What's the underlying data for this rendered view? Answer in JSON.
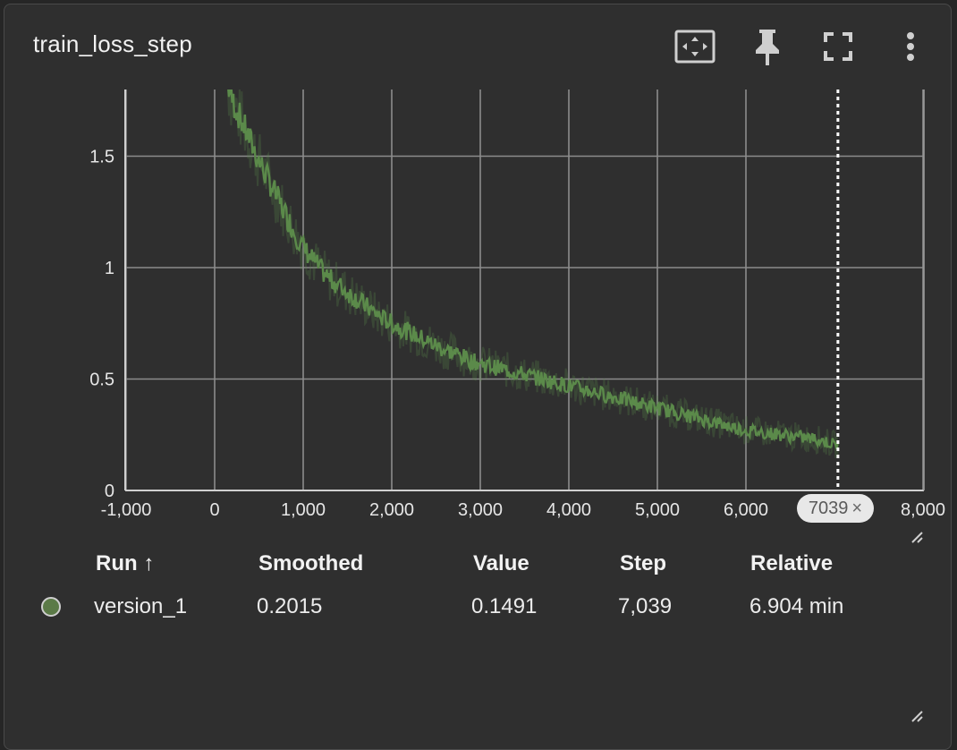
{
  "card": {
    "title": "train_loss_step"
  },
  "toolbar": {
    "fit_icon": "fit-domain-icon",
    "pin_icon": "pin-icon",
    "fullscreen_icon": "fullscreen-icon",
    "more_icon": "more-vert-icon"
  },
  "chart_data": {
    "type": "line",
    "title": "train_loss_step",
    "xlabel": "",
    "ylabel": "",
    "xlim": [
      -1000,
      8000
    ],
    "ylim": [
      0,
      1.8
    ],
    "x_ticks": [
      -1000,
      0,
      1000,
      2000,
      3000,
      4000,
      5000,
      6000,
      8000
    ],
    "x_tick_labels": [
      "-1,000",
      "0",
      "1,000",
      "2,000",
      "3,000",
      "4,000",
      "5,000",
      "6,000",
      "8,000"
    ],
    "y_ticks": [
      0,
      0.5,
      1,
      1.5
    ],
    "y_tick_labels": [
      "0",
      "0.5",
      "1",
      "1.5"
    ],
    "grid": true,
    "series": [
      {
        "name": "version_1",
        "color": "#5b8a4a",
        "smoothed": [
          [
            150,
            1.82
          ],
          [
            200,
            1.75
          ],
          [
            300,
            1.66
          ],
          [
            400,
            1.57
          ],
          [
            500,
            1.48
          ],
          [
            600,
            1.4
          ],
          [
            700,
            1.32
          ],
          [
            800,
            1.24
          ],
          [
            900,
            1.16
          ],
          [
            1000,
            1.09
          ],
          [
            1100,
            1.04
          ],
          [
            1200,
            0.99
          ],
          [
            1300,
            0.95
          ],
          [
            1400,
            0.92
          ],
          [
            1500,
            0.89
          ],
          [
            1600,
            0.86
          ],
          [
            1700,
            0.83
          ],
          [
            1800,
            0.8
          ],
          [
            1900,
            0.77
          ],
          [
            2000,
            0.75
          ],
          [
            2100,
            0.73
          ],
          [
            2200,
            0.71
          ],
          [
            2300,
            0.69
          ],
          [
            2400,
            0.67
          ],
          [
            2500,
            0.65
          ],
          [
            2600,
            0.63
          ],
          [
            2700,
            0.62
          ],
          [
            2800,
            0.6
          ],
          [
            2900,
            0.58
          ],
          [
            3000,
            0.57
          ],
          [
            3200,
            0.55
          ],
          [
            3400,
            0.53
          ],
          [
            3600,
            0.51
          ],
          [
            3800,
            0.49
          ],
          [
            4000,
            0.47
          ],
          [
            4200,
            0.45
          ],
          [
            4400,
            0.43
          ],
          [
            4600,
            0.41
          ],
          [
            4800,
            0.39
          ],
          [
            5000,
            0.37
          ],
          [
            5200,
            0.35
          ],
          [
            5400,
            0.33
          ],
          [
            5600,
            0.31
          ],
          [
            5800,
            0.29
          ],
          [
            6000,
            0.27
          ],
          [
            6200,
            0.26
          ],
          [
            6400,
            0.25
          ],
          [
            6600,
            0.24
          ],
          [
            6800,
            0.23
          ],
          [
            7039,
            0.2015
          ]
        ]
      }
    ],
    "marker": {
      "step": 7039,
      "label": "7039"
    }
  },
  "table": {
    "headers": [
      "Run ↑",
      "Smoothed",
      "Value",
      "Step",
      "Relative"
    ],
    "rows": [
      {
        "run": "version_1",
        "smoothed": "0.2015",
        "value": "0.1491",
        "step": "7,039",
        "relative": "6.904 min",
        "color": "#5b7a47"
      }
    ]
  }
}
